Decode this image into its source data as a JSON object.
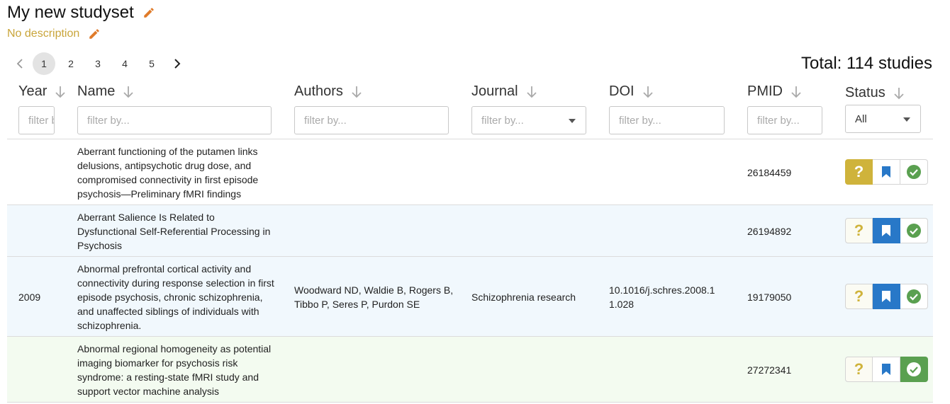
{
  "header": {
    "title": "My new studyset",
    "description": "No description"
  },
  "pagination": {
    "pages": [
      "1",
      "2",
      "3",
      "4",
      "5"
    ],
    "current": "1"
  },
  "total": "Total: 114 studies",
  "columns": {
    "year": "Year",
    "name": "Name",
    "authors": "Authors",
    "journal": "Journal",
    "doi": "DOI",
    "pmid": "PMID",
    "status": "Status"
  },
  "filters": {
    "placeholder": "filter by...",
    "year_placeholder": "filter by...",
    "status_value": "All"
  },
  "rows": [
    {
      "year": "",
      "name": "Aberrant functioning of the putamen links delusions, antipsychotic drug dose, and compromised connectivity in first episode psychosis—Preliminary fMRI findings",
      "authors": "",
      "journal": "",
      "doi": "",
      "pmid": "26184459",
      "status": "uncategorized"
    },
    {
      "year": "",
      "name": "Aberrant Salience Is Related to Dysfunctional Self-Referential Processing in Psychosis",
      "authors": "",
      "journal": "",
      "doi": "",
      "pmid": "26194892",
      "status": "saved"
    },
    {
      "year": "2009",
      "name": "Abnormal prefrontal cortical activity and connectivity during response selection in first episode psychosis, chronic schizophrenia, and unaffected siblings of individuals with schizophrenia.",
      "authors": "Woodward ND, Waldie B, Rogers B, Tibbo P, Seres P, Purdon SE",
      "journal": "Schizophrenia research",
      "doi": "10.1016/j.schres.2008.1 1.028",
      "pmid": "19179050",
      "status": "saved"
    },
    {
      "year": "",
      "name": "Abnormal regional homogeneity as potential imaging biomarker for psychosis risk syndrome: a resting-state fMRI study and support vector machine analysis",
      "authors": "",
      "journal": "",
      "doi": "",
      "pmid": "27272341",
      "status": "included"
    }
  ],
  "icons": {
    "edit": "pencil-icon",
    "sort": "arrow-down-icon",
    "prev": "chevron-left-icon",
    "next": "chevron-right-icon",
    "uncategorized": "question-mark-icon",
    "saved": "bookmark-icon",
    "included": "check-circle-icon"
  },
  "colors": {
    "accent_orange": "#e07b2a",
    "description": "#c9a53a",
    "uncategorized": "#cfb33b",
    "saved": "#2878c8",
    "included": "#5aa050",
    "row_blue": "#f1f8fd",
    "row_green": "#f3fbf0"
  }
}
